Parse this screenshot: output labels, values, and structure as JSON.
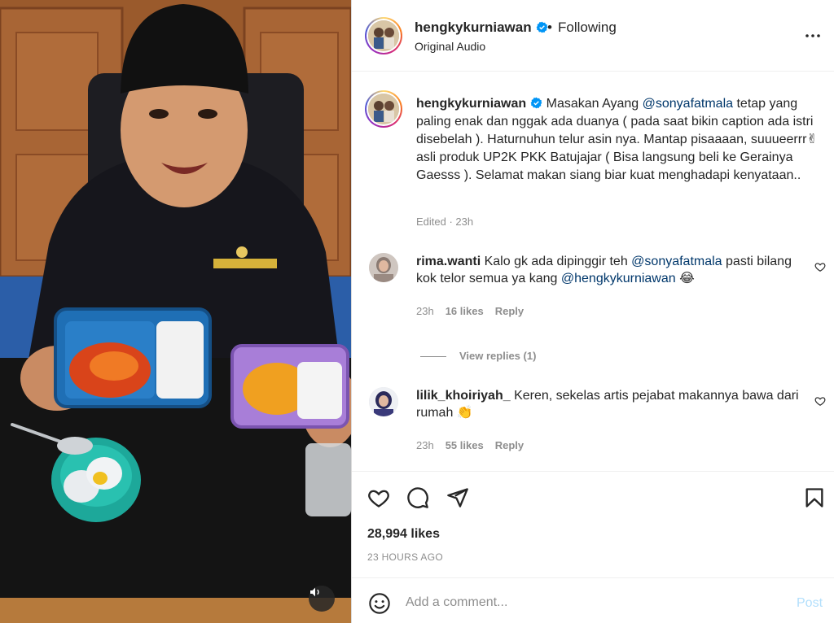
{
  "post": {
    "username": "hengkykurniawan",
    "follow_status": "Following",
    "audio": "Original Audio",
    "caption_text": "Masakan Ayang @sonyafatmala tetap yang paling enak dan nggak ada duanya ( pada saat bikin caption ada istri disebelah ). Haturnuhun telur asin nya. Mantap pisaaaan, suuueerrr✌ asli produk UP2K PKK Batujajar ( Bisa langsung beli ke Gerainya Gaesss ). Selamat makan siang biar kuat menghadapi kenyataan..",
    "caption_parts": {
      "before_mention": "Masakan Ayang ",
      "mention": "@sonyafatmala",
      "after_mention": " tetap yang paling enak dan nggak ada duanya ( pada saat bikin caption ada istri disebelah ). Haturnuhun telur asin nya. Mantap pisaaaan, suuueerrr✌ asli produk UP2K PKK Batujajar ( Bisa langsung beli ke Gerainya Gaesss ). Selamat makan siang biar kuat menghadapi kenyataan.."
    },
    "caption_meta": "Edited · 23h",
    "likes": "28,994 likes",
    "timestamp": "23 HOURS AGO"
  },
  "comments": [
    {
      "username": "rima.wanti",
      "text_a": "Kalo gk ada dipinggir teh ",
      "mention_a": "@sonyafatmala",
      "text_b": " pasti bilang kok telor semua ya kang ",
      "mention_b": "@hengkykurniawan",
      "emoji": "😂",
      "age": "23h",
      "likes": "16 likes",
      "reply": "Reply",
      "view_replies": "View replies (1)"
    },
    {
      "username": "lilik_khoiriyah_",
      "text": "Keren, sekelas artis pejabat makannya bawa dari rumah ",
      "emoji": "👏",
      "age": "23h",
      "likes": "55 likes",
      "reply": "Reply"
    }
  ],
  "composer": {
    "placeholder": "Add a comment...",
    "post_label": "Post"
  },
  "icons": {
    "like": "heart-icon",
    "comment": "comment-icon",
    "share": "share-icon",
    "save": "bookmark-icon",
    "more": "more-options-icon",
    "emoji": "emoji-icon",
    "sound": "speaker-icon",
    "verified": "verified-badge-icon"
  },
  "colors": {
    "link": "#00376b",
    "verified": "#0095f6",
    "muted": "#8e8e8e",
    "post_disabled": "#b2dffc"
  }
}
